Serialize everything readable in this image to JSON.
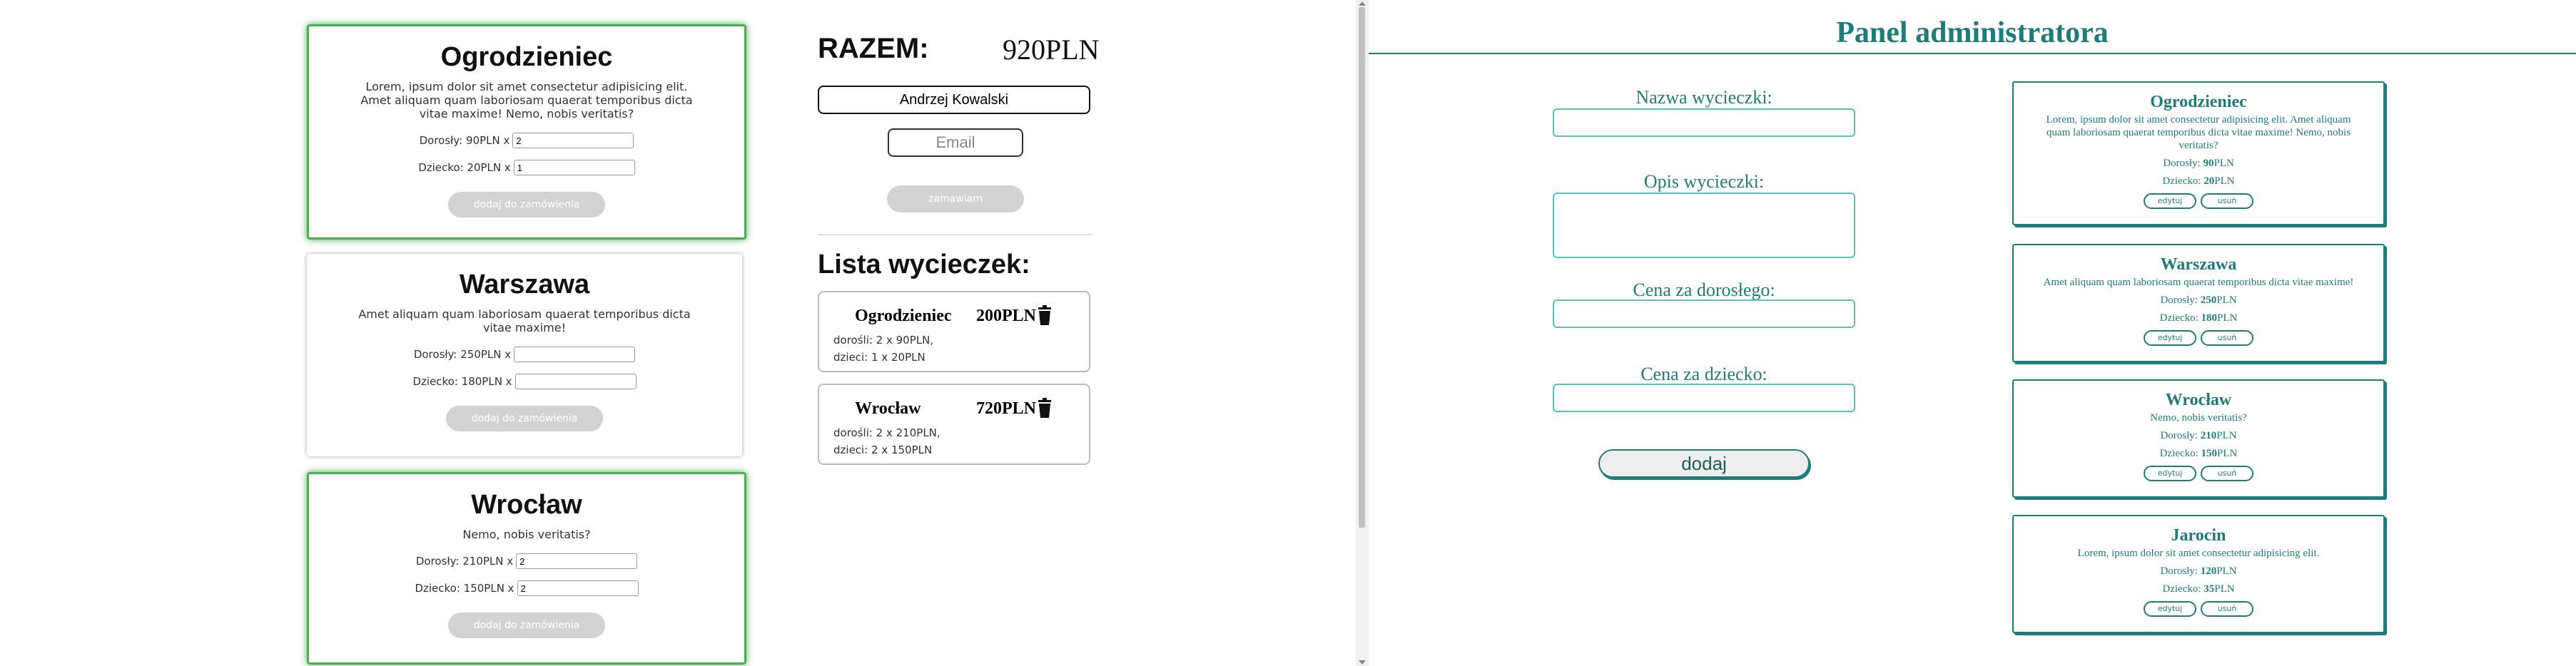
{
  "left_cards": [
    {
      "title": "Ogrodzieniec",
      "desc": "Lorem, ipsum dolor sit amet consectetur adipisicing elit. Amet aliquam quam laboriosam quaerat temporibus dicta vitae maxime! Nemo, nobis veritatis?",
      "adult_label": "Dorosły: 90PLN x",
      "adult_value": "2",
      "child_label": "Dziecko: 20PLN x",
      "child_value": "1",
      "button": "dodaj do zamówienia"
    },
    {
      "title": "Warszawa",
      "desc": "Amet aliquam quam laboriosam quaerat temporibus dicta vitae maxime!",
      "adult_label": "Dorosły: 250PLN x",
      "adult_value": "",
      "child_label": "Dziecko: 180PLN x",
      "child_value": "",
      "button": "dodaj do zamówienia"
    },
    {
      "title": "Wrocław",
      "desc": "Nemo, nobis veritatis?",
      "adult_label": "Dorosły: 210PLN x",
      "adult_value": "2",
      "child_label": "Dziecko: 150PLN x",
      "child_value": "2",
      "button": "dodaj do zamówienia"
    }
  ],
  "summary": {
    "razem_label": "RAZEM:",
    "razem_value": "920PLN",
    "name_value": "Andrzej Kowalski",
    "email_placeholder": "Email",
    "order_button": "zamawiam",
    "list_title": "Lista wycieczek:"
  },
  "trips": [
    {
      "name": "Ogrodzieniec",
      "price": "200PLN",
      "line1": "dorośli: 2 x 90PLN,",
      "line2": "dzieci: 1 x 20PLN"
    },
    {
      "name": "Wrocław",
      "price": "720PLN",
      "line1": "dorośli: 2 x 210PLN,",
      "line2": "dzieci: 2 x 150PLN"
    }
  ],
  "admin": {
    "title": "Panel administratora",
    "name_label": "Nazwa wycieczki:",
    "desc_label": "Opis wycieczki:",
    "adult_label": "Cena za dorosłego:",
    "child_label": "Cena za dziecko:",
    "add_button": "dodaj",
    "cards": [
      {
        "title": "Ogrodzieniec",
        "desc": "Lorem, ipsum dolor sit amet consectetur adipisicing elit. Amet aliquam quam laboriosam quaerat temporibus dicta vitae maxime! Nemo, nobis veritatis?",
        "adult_prefix": "Dorosły: ",
        "adult": "90",
        "adult_suffix": "PLN",
        "child_prefix": "Dziecko: ",
        "child": "20",
        "child_suffix": "PLN",
        "edit": "edytuj",
        "del": "usuń"
      },
      {
        "title": "Warszawa",
        "desc": "Amet aliquam quam laboriosam quaerat temporibus dicta vitae maxime!",
        "adult_prefix": "Dorosły: ",
        "adult": "250",
        "adult_suffix": "PLN",
        "child_prefix": "Dziecko: ",
        "child": "180",
        "child_suffix": "PLN",
        "edit": "edytuj",
        "del": "usuń"
      },
      {
        "title": "Wrocław",
        "desc": "Nemo, nobis veritatis?",
        "adult_prefix": "Dorosły: ",
        "adult": "210",
        "adult_suffix": "PLN",
        "child_prefix": "Dziecko: ",
        "child": "150",
        "child_suffix": "PLN",
        "edit": "edytuj",
        "del": "usuń"
      },
      {
        "title": "Jarocin",
        "desc": "Lorem, ipsum dolor sit amet consectetur adipisicing elit.",
        "adult_prefix": "Dorosły: ",
        "adult": "120",
        "adult_suffix": "PLN",
        "child_prefix": "Dziecko: ",
        "child": "35",
        "child_suffix": "PLN",
        "edit": "edytuj",
        "del": "usuń"
      }
    ]
  },
  "colors": {
    "accent": "#1f7c7c",
    "selected": "#4caf50",
    "disabled": "#d3d3d3"
  },
  "icons": {
    "trash": "trash-icon"
  }
}
